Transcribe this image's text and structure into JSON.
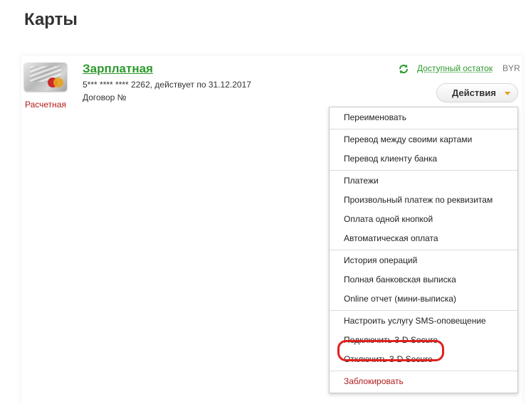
{
  "page": {
    "title": "Карты"
  },
  "card": {
    "name": "Зарплатная",
    "number_line": "5*** **** **** 2262, действует по 31.12.2017",
    "contract": "Договор №",
    "type_label": "Расчетная",
    "balance_link": "Доступный остаток",
    "currency": "BYR",
    "actions_label": "Действия"
  },
  "menu": {
    "groups": [
      {
        "items": [
          "Переименовать"
        ]
      },
      {
        "items": [
          "Перевод между своими картами",
          "Перевод клиенту банка"
        ]
      },
      {
        "items": [
          "Платежи",
          "Произвольный платеж по реквизитам",
          "Оплата одной кнопкой",
          "Автоматическая оплата"
        ]
      },
      {
        "items": [
          "История операций",
          "Полная банковская выписка",
          "Online отчет (мини-выписка)"
        ]
      },
      {
        "items": [
          "Настроить услугу SMS-оповещение",
          "Подключить 3-D Secure",
          "Отключить 3-D Secure"
        ]
      },
      {
        "items": [
          "Заблокировать"
        ]
      }
    ]
  },
  "colors": {
    "accent_green": "#2d9a2d",
    "danger_red": "#b21a1a",
    "highlight_red": "#e0201c",
    "caret_orange": "#e79b1b"
  },
  "icons": {
    "refresh": "refresh-icon",
    "card_logo": "mastercard-logo-icon",
    "caret": "chevron-down-icon"
  }
}
